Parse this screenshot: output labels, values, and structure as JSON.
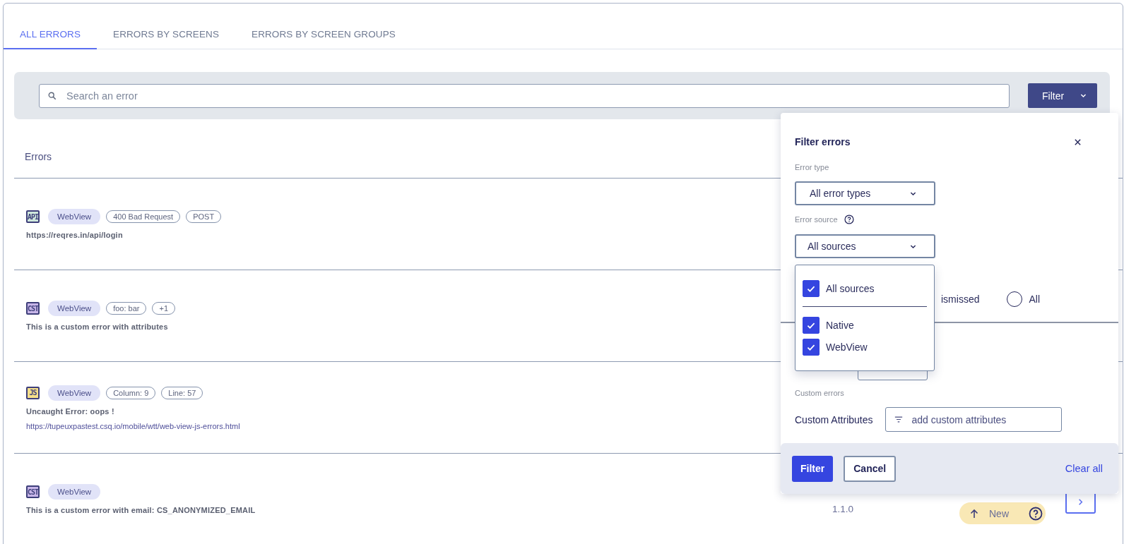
{
  "tabs": [
    {
      "label": "ALL ERRORS",
      "selected": true
    },
    {
      "label": "ERRORS BY SCREENS",
      "selected": false
    },
    {
      "label": "ERRORS BY SCREEN GROUPS",
      "selected": false
    }
  ],
  "search": {
    "placeholder": "Search an error"
  },
  "filter_button": {
    "label": "Filter"
  },
  "list": {
    "heading": "Errors",
    "rows": [
      {
        "kind": "api",
        "type_label": "API",
        "tags": [
          {
            "kind": "platform",
            "label": "WebView"
          },
          {
            "kind": "attribute",
            "label": "400 Bad Request"
          },
          {
            "kind": "attribute",
            "label": "POST"
          }
        ],
        "lines": [
          {
            "kind": "message",
            "text": "https://reqres.in/api/login"
          }
        ]
      },
      {
        "kind": "cst",
        "type_label": "CST",
        "tags": [
          {
            "kind": "platform",
            "label": "WebView"
          },
          {
            "kind": "attribute",
            "label": "foo: bar"
          },
          {
            "kind": "attribute",
            "label": "+1"
          }
        ],
        "lines": [
          {
            "kind": "message",
            "text": "This is a custom error with attributes"
          }
        ]
      },
      {
        "kind": "js",
        "type_label": "JS",
        "tags": [
          {
            "kind": "platform",
            "label": "WebView"
          },
          {
            "kind": "attribute",
            "label": "Column: 9"
          },
          {
            "kind": "attribute",
            "label": "Line: 57"
          }
        ],
        "lines": [
          {
            "kind": "message",
            "text": "Uncaught Error: oops !"
          },
          {
            "kind": "link",
            "text": "https://tupeuxpastest.csq.io/mobile/wtt/web-view-js-errors.html"
          }
        ]
      },
      {
        "kind": "cst",
        "type_label": "CST",
        "tags": [
          {
            "kind": "platform",
            "label": "WebView"
          }
        ],
        "lines": [
          {
            "kind": "message",
            "text": "This is a custom error with email: CS_ANONYMIZED_EMAIL"
          }
        ],
        "version": "1.1.0",
        "status": {
          "label": "New"
        }
      }
    ]
  },
  "filter_panel": {
    "title": "Filter errors",
    "error_type": {
      "label": "Error type",
      "value": "All error types"
    },
    "error_source": {
      "label": "Error source",
      "value": "All sources",
      "expanded": true,
      "options": [
        {
          "kind": "all",
          "label": "All sources",
          "checked": true
        },
        {
          "kind": "item",
          "label": "Native",
          "checked": true
        },
        {
          "kind": "item",
          "label": "WebView",
          "checked": true
        }
      ]
    },
    "status": {
      "partial_label": "ismissed",
      "options": [
        {
          "label": "All",
          "selected": false
        }
      ]
    },
    "custom_errors": {
      "label": "Custom errors",
      "field_label": "Custom Attributes",
      "placeholder": "add custom attributes"
    },
    "buttons": [
      {
        "kind": "primary",
        "label": "Filter"
      },
      {
        "kind": "secondary",
        "label": "Cancel"
      },
      {
        "kind": "link",
        "label": "Clear all"
      }
    ]
  }
}
